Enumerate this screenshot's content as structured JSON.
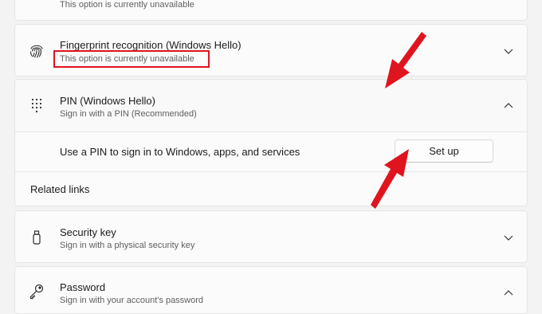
{
  "top_row": {
    "subtitle": "This option is currently unavailable"
  },
  "fingerprint": {
    "title": "Fingerprint recognition (Windows Hello)",
    "subtitle": "This option is currently unavailable",
    "icon": "fingerprint-icon"
  },
  "pin": {
    "title": "PIN (Windows Hello)",
    "subtitle": "Sign in with a PIN (Recommended)",
    "icon": "keypad-icon",
    "description": "Use a PIN to sign in to Windows, apps, and services",
    "setup_label": "Set up",
    "related_links_label": "Related links"
  },
  "security_key": {
    "title": "Security key",
    "subtitle": "Sign in with a physical security key",
    "icon": "usb-key-icon"
  },
  "password": {
    "title": "Password",
    "subtitle": "Sign in with your account's password",
    "icon": "key-icon"
  },
  "annotation_color": "#e0141e"
}
